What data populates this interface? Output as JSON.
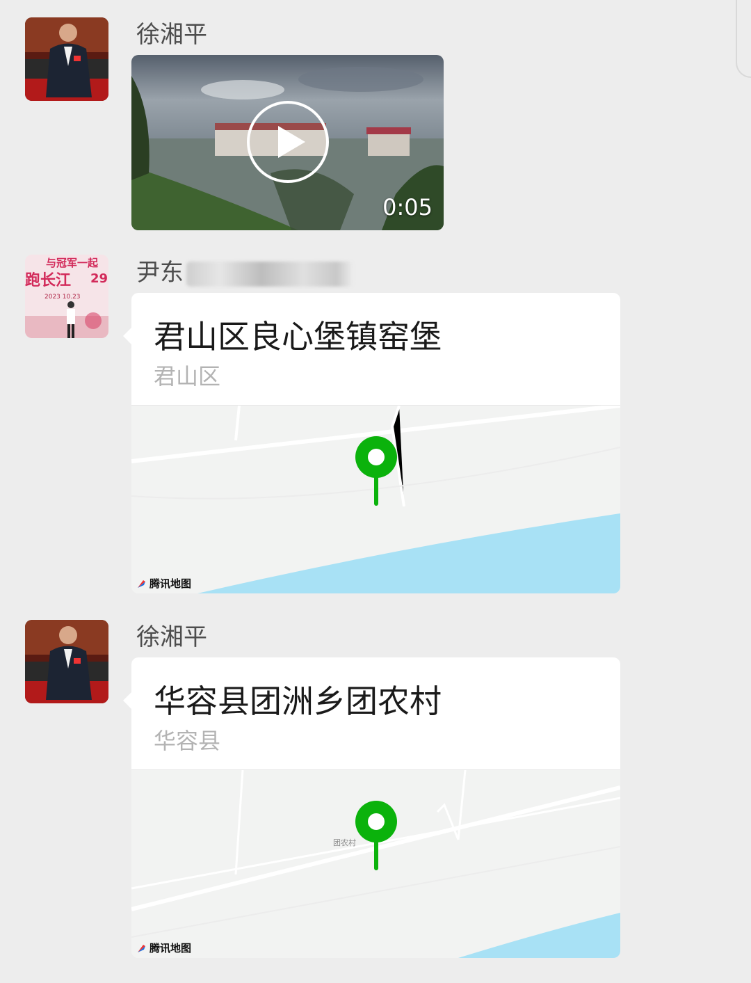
{
  "messages": [
    {
      "sender": "徐湘平",
      "type": "video",
      "duration": "0:05"
    },
    {
      "sender": "尹东",
      "type": "location",
      "title": "君山区良心堡镇窑堡",
      "subtitle": "君山区",
      "map_provider": "腾讯地图"
    },
    {
      "sender": "徐湘平",
      "type": "location",
      "title": "华容县团洲乡团农村",
      "subtitle": "华容县",
      "map_label": "团农村",
      "map_provider": "腾讯地图"
    }
  ],
  "avatar2_poster": {
    "line1": "与冠军一起",
    "line2": "跑长江",
    "number": "29",
    "date": "2023  10.23"
  },
  "colors": {
    "pin": "#0bb20c",
    "water": "#a8e1f5",
    "background": "#ededed"
  },
  "icons": [
    "play-icon",
    "location-pin-icon",
    "tencent-map-logo-icon"
  ]
}
